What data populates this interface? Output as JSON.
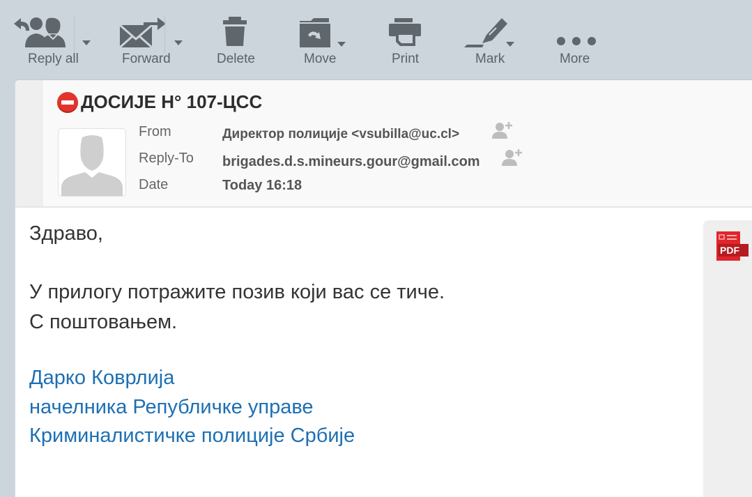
{
  "toolbar": {
    "reply_all": "Reply all",
    "forward": "Forward",
    "delete": "Delete",
    "move": "Move",
    "print": "Print",
    "mark": "Mark",
    "more": "More"
  },
  "message": {
    "subject": "ДОСИЈЕ Н° 107-ЦСС",
    "subject_icon": "no-entry-icon",
    "from_label": "From",
    "from_value": "Директор полиције <vsubilla@uc.cl>",
    "reply_to_label": "Reply-To",
    "reply_to_value": "brigades.d.s.mineurs.gour@gmail.com",
    "date_label": "Date",
    "date_value": "Today 16:18"
  },
  "body": {
    "greeting": "Здраво,",
    "line1": "У прилогу потражите позив који вас се тиче.",
    "line2": "С поштовањем.",
    "signature": [
      "Дарко Коврлија",
      "начелника Републичке управе",
      "Криминалистичке полиције Србије"
    ]
  },
  "attachment": {
    "type_label": "PDF"
  },
  "colors": {
    "toolbar_bg": "#ccd4dc",
    "icon_gray": "#5f666c",
    "signature_blue": "#1d6fb3",
    "pdf_red": "#e0262b"
  }
}
